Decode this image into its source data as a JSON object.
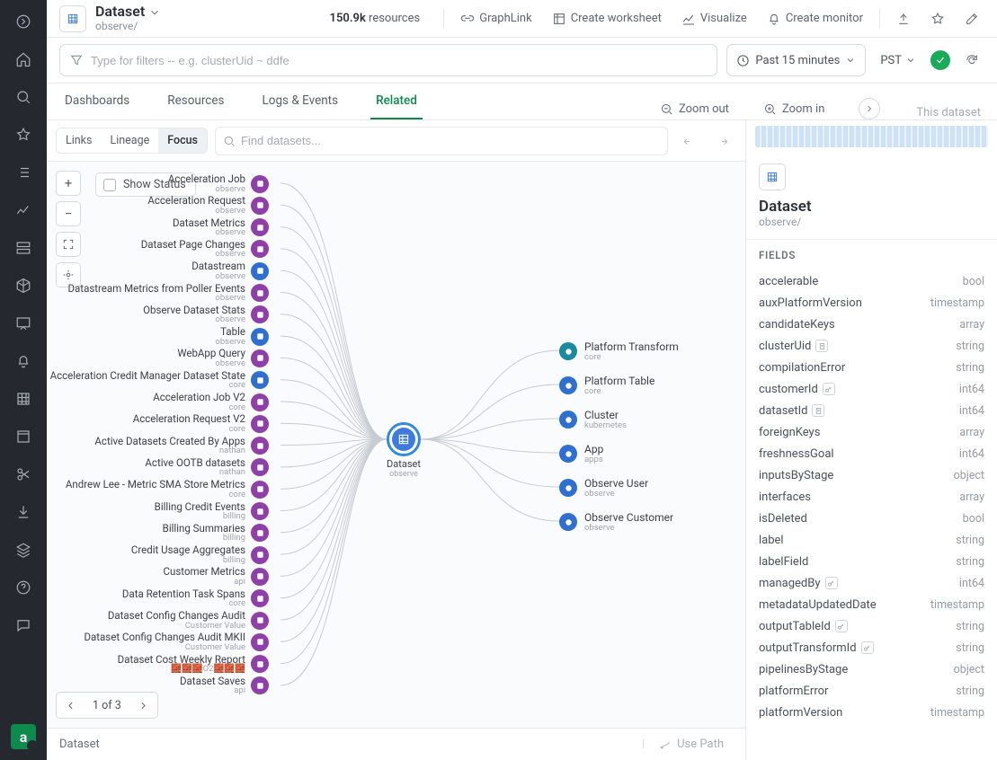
{
  "header": {
    "title": "Dataset",
    "path": "observe/",
    "resource_count": "150.9k",
    "resource_label": "resources",
    "actions": {
      "graphlink": "GraphLink",
      "create_worksheet": "Create worksheet",
      "visualize": "Visualize",
      "create_monitor": "Create monitor"
    }
  },
  "filter": {
    "placeholder": "Type for filters -- e.g. clusterUid ~ ddfe",
    "timerange": "Past 15 minutes",
    "timezone": "PST"
  },
  "tabs": {
    "items": [
      "Dashboards",
      "Resources",
      "Logs & Events",
      "Related"
    ],
    "active": "Related",
    "zoom_out": "Zoom out",
    "zoom_in": "Zoom in",
    "inspector_tab": "This dataset"
  },
  "subtabs": {
    "items": [
      "Links",
      "Lineage",
      "Focus"
    ],
    "active": "Focus",
    "find_placeholder": "Find datasets..."
  },
  "graph": {
    "show_status_label": "Show Status",
    "center": {
      "label": "Dataset",
      "sub": "observe"
    },
    "pager": "1 of 3",
    "in_nodes": [
      {
        "t": "Acceleration Job",
        "s": "observe",
        "c": "c-purple"
      },
      {
        "t": "Acceleration Request",
        "s": "observe",
        "c": "c-purple"
      },
      {
        "t": "Dataset Metrics",
        "s": "observe",
        "c": "c-purple"
      },
      {
        "t": "Dataset Page Changes",
        "s": "observe",
        "c": "c-purple"
      },
      {
        "t": "Datastream",
        "s": "observe",
        "c": "c-blue"
      },
      {
        "t": "Datastream Metrics from Poller Events",
        "s": "observe",
        "c": "c-purple"
      },
      {
        "t": "Observe Dataset Stats",
        "s": "observe",
        "c": "c-purple"
      },
      {
        "t": "Table",
        "s": "observe",
        "c": "c-blue"
      },
      {
        "t": "WebApp Query",
        "s": "observe",
        "c": "c-purple"
      },
      {
        "t": "Acceleration Credit Manager Dataset State",
        "s": "core",
        "c": "c-blue"
      },
      {
        "t": "Acceleration Job V2",
        "s": "core",
        "c": "c-purple"
      },
      {
        "t": "Acceleration Request V2",
        "s": "core",
        "c": "c-purple"
      },
      {
        "t": "Active Datasets Created By Apps",
        "s": "nathan",
        "c": "c-purple"
      },
      {
        "t": "Active OOTB datasets",
        "s": "nathan",
        "c": "c-purple"
      },
      {
        "t": "Andrew Lee - Metric SMA Store Metrics",
        "s": "core",
        "c": "c-purple"
      },
      {
        "t": "Billing Credit Events",
        "s": "billing",
        "c": "c-purple"
      },
      {
        "t": "Billing Summaries",
        "s": "billing",
        "c": "c-purple"
      },
      {
        "t": "Credit Usage Aggregates",
        "s": "billing",
        "c": "c-purple"
      },
      {
        "t": "Customer Metrics",
        "s": "api",
        "c": "c-purple"
      },
      {
        "t": "Data Retention Task Spans",
        "s": "core",
        "c": "c-purple"
      },
      {
        "t": "Dataset Config Changes Audit",
        "s": "Customer Value",
        "c": "c-purple"
      },
      {
        "t": "Dataset Config Changes Audit MKII",
        "s": "Customer Value",
        "c": "c-purple"
      },
      {
        "t": "Dataset Cost Weekly Report",
        "s": "🧱🧱🧱O2🧱🧱🧱",
        "c": "c-purple"
      },
      {
        "t": "Dataset Saves",
        "s": "api",
        "c": "c-purple"
      }
    ],
    "out_nodes": [
      {
        "t": "Platform Transform",
        "s": "core",
        "c": "c-teal"
      },
      {
        "t": "Platform Table",
        "s": "core",
        "c": "c-blue"
      },
      {
        "t": "Cluster",
        "s": "kubernetes",
        "c": "c-blue"
      },
      {
        "t": "App",
        "s": "apps",
        "c": "c-blue"
      },
      {
        "t": "Observe User",
        "s": "observe",
        "c": "c-blue"
      },
      {
        "t": "Observe Customer",
        "s": "observe",
        "c": "c-blue"
      }
    ]
  },
  "bottom": {
    "label": "Dataset",
    "use_path": "Use Path"
  },
  "inspector": {
    "title": "Dataset",
    "path": "observe/",
    "fields_label": "FIELDS",
    "fields": [
      {
        "name": "accelerable",
        "type": "bool"
      },
      {
        "name": "auxPlatformVersion",
        "type": "timestamp"
      },
      {
        "name": "candidateKeys",
        "type": "array"
      },
      {
        "name": "clusterUid",
        "type": "string",
        "key": "doc"
      },
      {
        "name": "compilationError",
        "type": "string"
      },
      {
        "name": "customerId",
        "type": "int64",
        "key": "key"
      },
      {
        "name": "datasetId",
        "type": "int64",
        "key": "doc"
      },
      {
        "name": "foreignKeys",
        "type": "array"
      },
      {
        "name": "freshnessGoal",
        "type": "int64"
      },
      {
        "name": "inputsByStage",
        "type": "object"
      },
      {
        "name": "interfaces",
        "type": "array"
      },
      {
        "name": "isDeleted",
        "type": "bool"
      },
      {
        "name": "label",
        "type": "string"
      },
      {
        "name": "labelField",
        "type": "string"
      },
      {
        "name": "managedBy",
        "type": "int64",
        "key": "key"
      },
      {
        "name": "metadataUpdatedDate",
        "type": "timestamp"
      },
      {
        "name": "outputTableId",
        "type": "string",
        "key": "key"
      },
      {
        "name": "outputTransformId",
        "type": "string",
        "key": "key"
      },
      {
        "name": "pipelinesByStage",
        "type": "object"
      },
      {
        "name": "platformError",
        "type": "string"
      },
      {
        "name": "platformVersion",
        "type": "timestamp"
      }
    ]
  }
}
